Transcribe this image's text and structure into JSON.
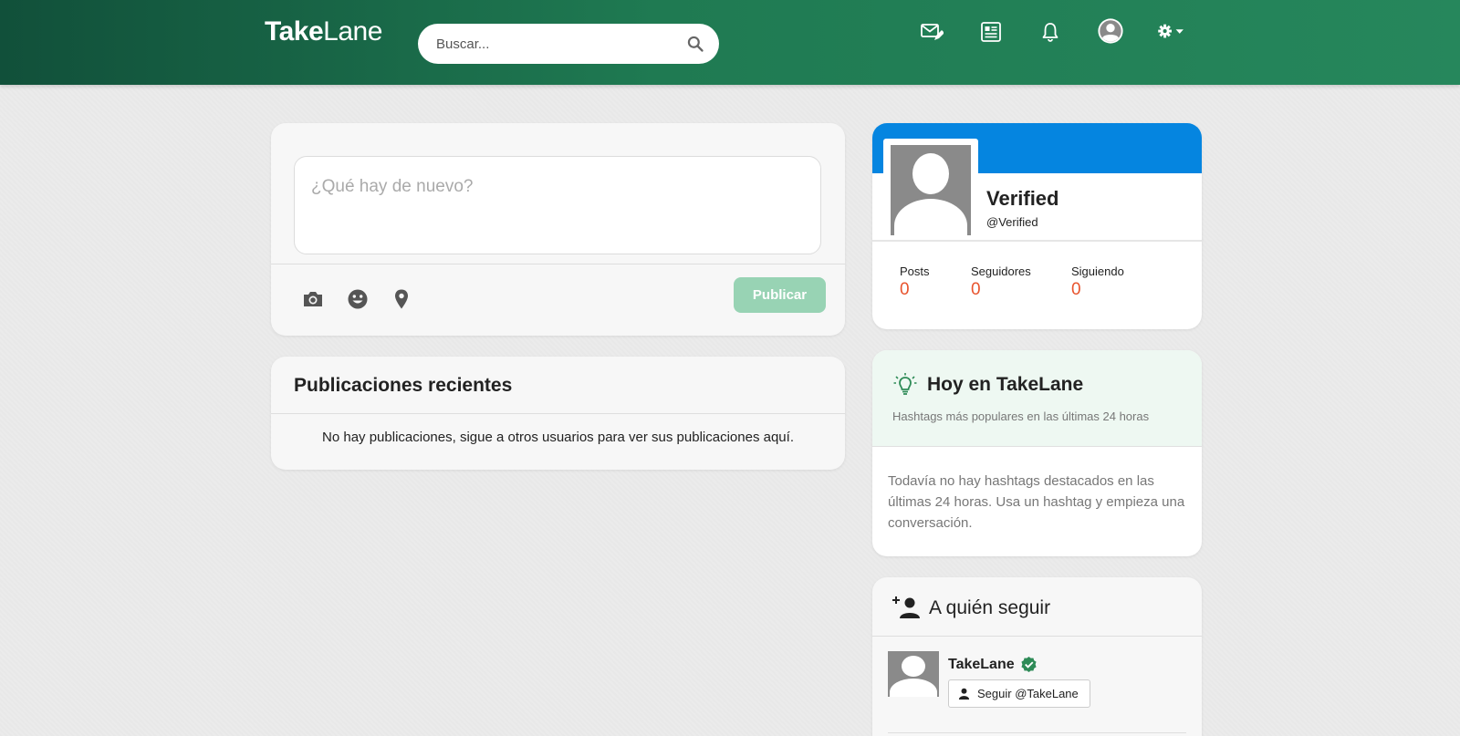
{
  "header": {
    "logo_bold": "Take",
    "logo_light": "Lane",
    "search_placeholder": "Buscar...",
    "icons": [
      "compose-message-icon",
      "news-icon",
      "bell-icon",
      "user-avatar-icon",
      "gear-icon"
    ]
  },
  "composer": {
    "placeholder": "¿Qué hay de nuevo?",
    "tools": [
      "camera-icon",
      "smiley-icon",
      "location-pin-icon"
    ],
    "publish_label": "Publicar"
  },
  "recent": {
    "title": "Publicaciones recientes",
    "empty_text": "No hay publicaciones, sigue a otros usuarios para ver sus publicaciones aquí."
  },
  "profile": {
    "name": "Verified",
    "handle": "@Verified",
    "stats": [
      {
        "label": "Posts",
        "value": "0"
      },
      {
        "label": "Seguidores",
        "value": "0"
      },
      {
        "label": "Siguiendo",
        "value": "0"
      }
    ]
  },
  "today": {
    "title": "Hoy en TakeLane",
    "subtitle": "Hashtags más populares en las últimas 24 horas",
    "empty_text": "Todavía no hay hashtags destacados en las últimas 24 horas. Usa un hashtag y empieza una conversación."
  },
  "who_to_follow": {
    "title": "A quién seguir",
    "users": [
      {
        "name": "TakeLane",
        "button_label": "Seguir @TakeLane",
        "verified": true
      }
    ]
  },
  "colors": {
    "accent_green": "#1f7a52",
    "profile_banner": "#0585e0",
    "stat_value": "#e8542e",
    "publish_button": "#98d3b4",
    "verified_badge": "#2e8b57"
  }
}
